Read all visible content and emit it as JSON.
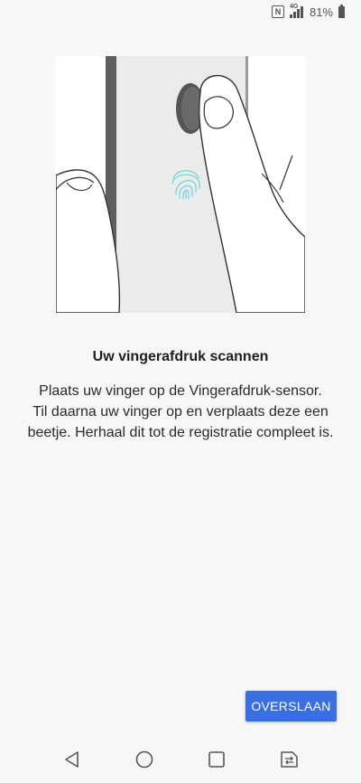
{
  "status_bar": {
    "network_label": "4G",
    "battery_percent": "81%",
    "icons": [
      "nfc-icon",
      "signal-icon",
      "battery-icon"
    ]
  },
  "illustration": {
    "icon": "fingerprint-icon",
    "accent_color": "#7fd3dd"
  },
  "content": {
    "title": "Uw vingerafdruk scannen",
    "body_lines": [
      "Plaats uw vinger op de Vingerafdruk-sensor.",
      "Til daarna uw vinger op en verplaats deze een",
      "beetje. Herhaal dit tot de registratie compleet is."
    ]
  },
  "actions": {
    "skip_label": "OVERSLAAN",
    "skip_color": "#3a6fe2"
  },
  "nav_bar": {
    "icons": [
      "back-icon",
      "home-icon",
      "recents-icon",
      "switch-sim-icon"
    ]
  }
}
